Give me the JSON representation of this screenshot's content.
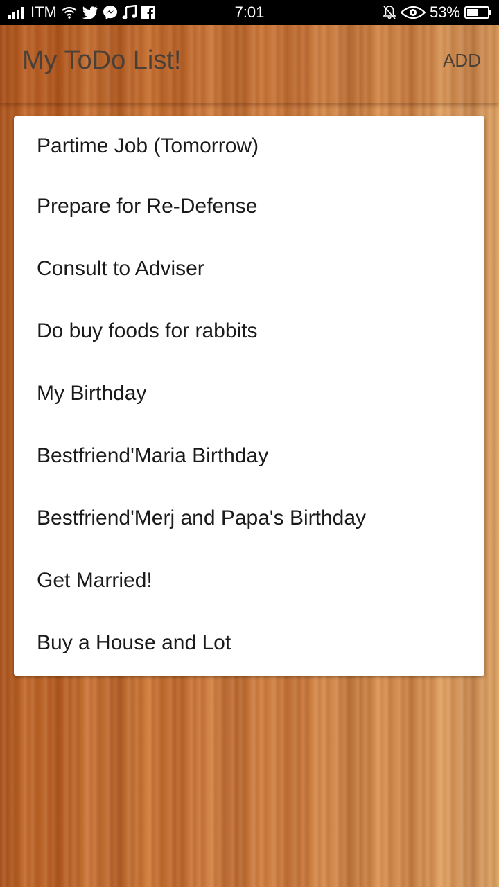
{
  "status_bar": {
    "carrier": "ITM",
    "time": "7:01",
    "battery_percent": "53%",
    "icons_left": [
      "signal-icon",
      "wifi-icon",
      "twitter-icon",
      "messenger-icon",
      "music-icon",
      "facebook-icon"
    ],
    "icons_right": [
      "notifications-off-icon",
      "eye-icon",
      "battery-icon"
    ],
    "battery_level": 0.53
  },
  "app_bar": {
    "title": "My ToDo List!",
    "add_label": "ADD"
  },
  "todos": [
    "Partime Job (Tomorrow)",
    "Prepare for Re-Defense",
    "Consult to Adviser",
    "Do buy foods for rabbits",
    "My Birthday",
    "Bestfriend'Maria Birthday",
    "Bestfriend'Merj and Papa's Birthday",
    "Get Married!",
    "Buy a House and Lot"
  ],
  "colors": {
    "status_bar_bg": "#000000",
    "title_text": "#4a4038",
    "card_bg": "#ffffff",
    "item_text": "#1a1a1a"
  }
}
